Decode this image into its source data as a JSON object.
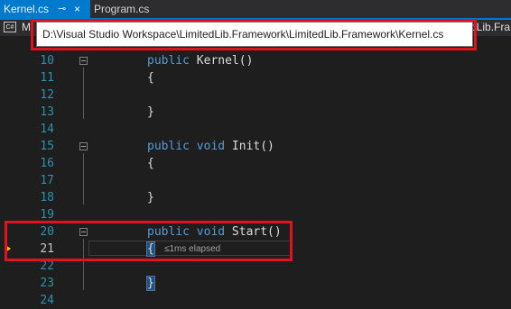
{
  "tabs": [
    {
      "label": "Kernel.cs",
      "active": true,
      "pin_glyph": "⊸",
      "close_glyph": "×"
    },
    {
      "label": "Program.cs",
      "active": false
    }
  ],
  "navbar": {
    "icon_text": "C#",
    "left_text": "M",
    "right_text": "dLib.Fra"
  },
  "tooltip": {
    "path": "D:\\Visual Studio Workspace\\LimitedLib.Framework\\LimitedLib.Framework\\Kernel.cs"
  },
  "editor": {
    "lines": [
      {
        "n": "10",
        "kw": "public ",
        "rest": "Kernel()"
      },
      {
        "n": "11",
        "kw": "",
        "rest": "{"
      },
      {
        "n": "12",
        "kw": "",
        "rest": ""
      },
      {
        "n": "13",
        "kw": "",
        "rest": "}"
      },
      {
        "n": "14",
        "kw": "",
        "rest": ""
      },
      {
        "n": "15",
        "kw": "public void ",
        "rest": "Init()"
      },
      {
        "n": "16",
        "kw": "",
        "rest": "{"
      },
      {
        "n": "17",
        "kw": "",
        "rest": ""
      },
      {
        "n": "18",
        "kw": "",
        "rest": "}"
      },
      {
        "n": "19",
        "kw": "",
        "rest": ""
      },
      {
        "n": "20",
        "kw": "public void ",
        "rest": "Start()"
      },
      {
        "n": "21",
        "kw": "",
        "rest": "{"
      },
      {
        "n": "22",
        "kw": "",
        "rest": ""
      },
      {
        "n": "23",
        "kw": "",
        "rest": "}"
      },
      {
        "n": "24",
        "kw": "",
        "rest": ""
      }
    ],
    "perf_tip": "≤1ms elapsed"
  },
  "colors": {
    "keyword": "#569cd6",
    "line_number": "#2b91af",
    "accent": "#007acc",
    "highlight_box": "#e0121d"
  }
}
